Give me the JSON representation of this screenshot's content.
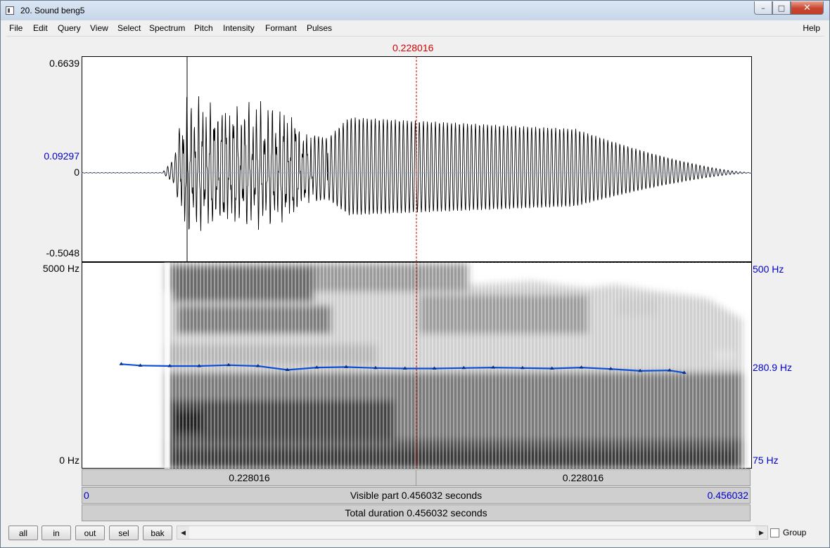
{
  "window": {
    "title": "20. Sound beng5"
  },
  "window_controls": {
    "minimize": "–",
    "maximize": "□",
    "close": "✕"
  },
  "menu": {
    "items": [
      "File",
      "Edit",
      "Query",
      "View",
      "Select",
      "Spectrum",
      "Pitch",
      "Intensity",
      "Formant",
      "Pulses"
    ],
    "help": "Help"
  },
  "cursor": {
    "time_label": "0.228016",
    "time": 0.228016
  },
  "waveform": {
    "max_label": "0.6639",
    "value_at_cursor_label": "0.09297",
    "zero_label": "0",
    "min_label": "-0.5048",
    "max": 0.6639,
    "min": -0.5048,
    "value_at_cursor": 0.09297
  },
  "spectrogram": {
    "freq_top_label": "5000 Hz",
    "freq_bottom_label": "0 Hz",
    "pitch_top_label": "500 Hz",
    "pitch_cursor_label": "280.9 Hz",
    "pitch_bottom_label": "75 Hz",
    "pitch_min": 75,
    "pitch_max": 500,
    "pitch_at_cursor": 280.9
  },
  "pitch_track": {
    "time": [
      0.027,
      0.04,
      0.06,
      0.08,
      0.1,
      0.12,
      0.14,
      0.16,
      0.18,
      0.2,
      0.22,
      0.24,
      0.26,
      0.28,
      0.3,
      0.32,
      0.34,
      0.36,
      0.38,
      0.4,
      0.41
    ],
    "hz": [
      290,
      287,
      286,
      286,
      288,
      286,
      278,
      283,
      284,
      282,
      281,
      281,
      282,
      283,
      282,
      281,
      283,
      280,
      276,
      277,
      272
    ]
  },
  "time_bars": {
    "left_selection_label": "0.228016",
    "right_selection_label": "0.228016",
    "visible_start_label": "0",
    "visible_part_label": "Visible part 0.456032 seconds",
    "visible_end_label": "0.456032",
    "total_duration_label": "Total duration 0.456032 seconds"
  },
  "nav_buttons": {
    "all": "all",
    "in": "in",
    "out": "out",
    "sel": "sel",
    "bak": "bak"
  },
  "scroll": {
    "left_arrow": "◀",
    "right_arrow": "▶"
  },
  "group_label": "Group",
  "colors": {
    "cursor": "#d40000",
    "pitch": "#0b4fd6",
    "axis_blue": "#0000c8"
  }
}
